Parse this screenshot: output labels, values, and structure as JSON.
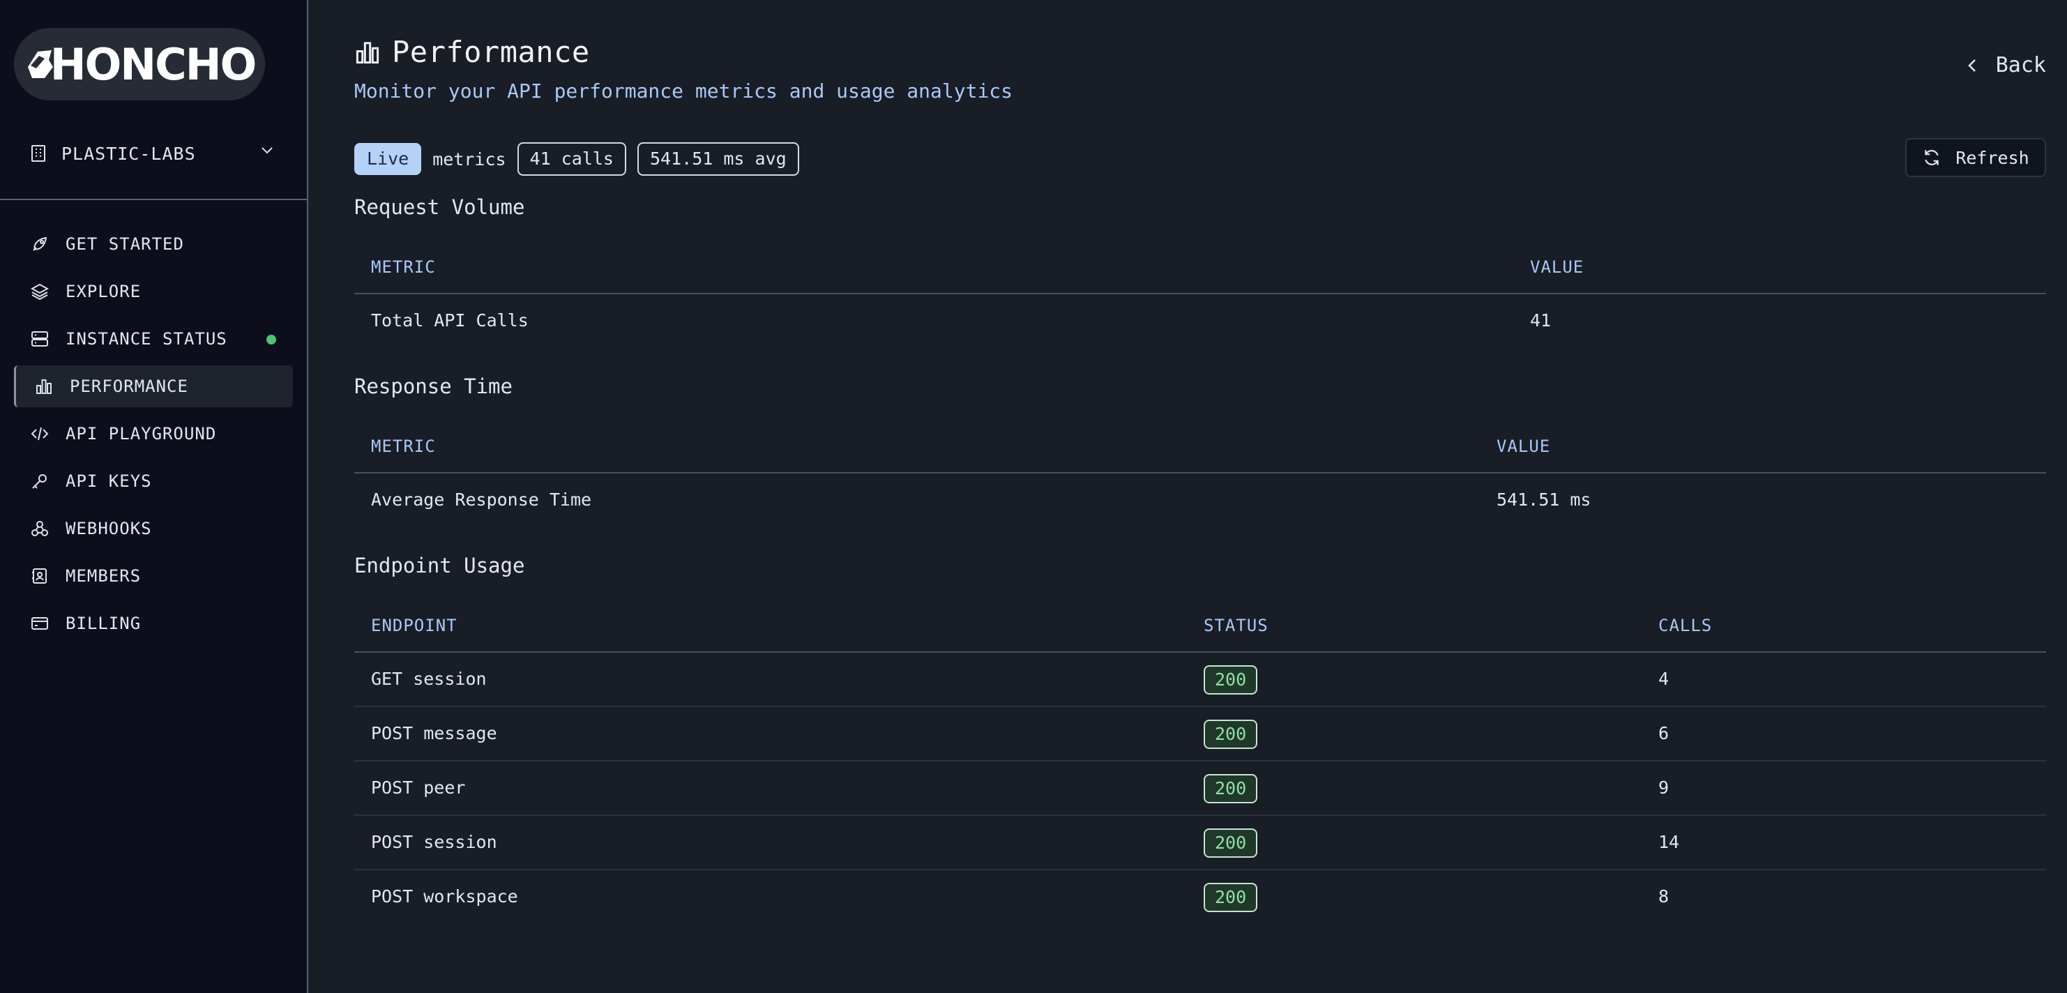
{
  "brand": {
    "logo_text": "HONCHO"
  },
  "org": {
    "name": "PLASTIC-LABS"
  },
  "nav": {
    "items": [
      {
        "label": "GET STARTED",
        "icon": "rocket-icon"
      },
      {
        "label": "EXPLORE",
        "icon": "layers-icon"
      },
      {
        "label": "INSTANCE STATUS",
        "icon": "server-icon",
        "status_color": "#4fc36e"
      },
      {
        "label": "PERFORMANCE",
        "icon": "bar-chart-icon",
        "active": true
      },
      {
        "label": "API PLAYGROUND",
        "icon": "code-icon"
      },
      {
        "label": "API KEYS",
        "icon": "key-icon"
      },
      {
        "label": "WEBHOOKS",
        "icon": "webhook-icon"
      },
      {
        "label": "MEMBERS",
        "icon": "contact-book-icon"
      },
      {
        "label": "BILLING",
        "icon": "credit-card-icon"
      }
    ]
  },
  "header": {
    "title": "Performance",
    "subtitle": "Monitor your API performance metrics and usage analytics",
    "back_label": "Back"
  },
  "summary": {
    "live_label": "Live",
    "metrics_label": "metrics",
    "calls_badge": "41 calls",
    "avg_badge": "541.51 ms avg",
    "refresh_label": "Refresh"
  },
  "request_volume": {
    "title": "Request Volume",
    "columns": [
      "METRIC",
      "VALUE"
    ],
    "rows": [
      {
        "metric": "Total API Calls",
        "value": "41"
      }
    ]
  },
  "response_time": {
    "title": "Response Time",
    "columns": [
      "METRIC",
      "VALUE"
    ],
    "rows": [
      {
        "metric": "Average Response Time",
        "value": "541.51 ms"
      }
    ]
  },
  "endpoint_usage": {
    "title": "Endpoint Usage",
    "columns": [
      "ENDPOINT",
      "STATUS",
      "CALLS"
    ],
    "rows": [
      {
        "endpoint": "GET session",
        "status": "200",
        "calls": "4"
      },
      {
        "endpoint": "POST message",
        "status": "200",
        "calls": "6"
      },
      {
        "endpoint": "POST peer",
        "status": "200",
        "calls": "9"
      },
      {
        "endpoint": "POST session",
        "status": "200",
        "calls": "14"
      },
      {
        "endpoint": "POST workspace",
        "status": "200",
        "calls": "8"
      }
    ]
  }
}
